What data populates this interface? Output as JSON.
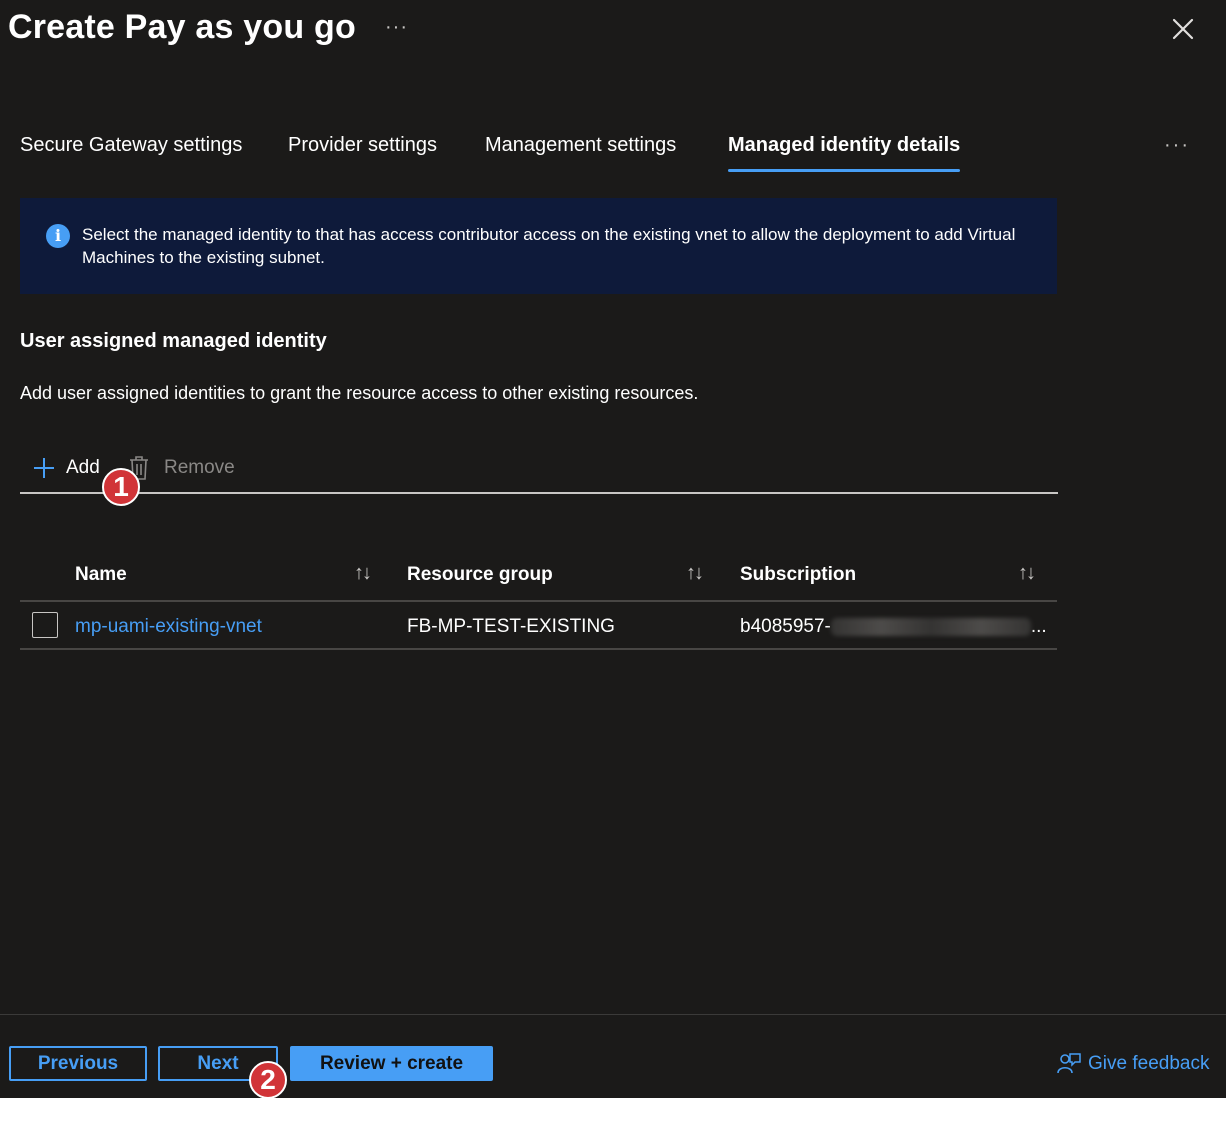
{
  "header": {
    "title": "Create Pay as you go",
    "more": "···"
  },
  "tabs": {
    "items": [
      {
        "label": "Secure Gateway settings"
      },
      {
        "label": "Provider settings"
      },
      {
        "label": "Management settings"
      },
      {
        "label": "Managed identity details",
        "active": true
      }
    ],
    "overflow": "···"
  },
  "info": {
    "icon": "info-icon",
    "text": "Select the managed identity to that has access contributor access on the existing vnet to allow the deployment to add Virtual Machines to the existing subnet."
  },
  "section": {
    "title": "User assigned managed identity",
    "description": "Add user assigned identities to grant the resource access to other existing resources."
  },
  "toolbar": {
    "add_label": "Add",
    "remove_label": "Remove"
  },
  "table": {
    "columns": [
      "Name",
      "Resource group",
      "Subscription"
    ],
    "sort_glyph": "↑↓",
    "rows": [
      {
        "name": "mp-uami-existing-vnet",
        "resource_group": "FB-MP-TEST-EXISTING",
        "subscription": "b4085957-",
        "subscription_suffix": "..."
      }
    ]
  },
  "annotations": {
    "badge1": "1",
    "badge2": "2",
    "badge_color": "#d13438"
  },
  "footer": {
    "previous_label": "Previous",
    "next_label": "Next",
    "review_label": "Review + create",
    "feedback_label": "Give feedback"
  },
  "colors": {
    "background": "#1b1a19",
    "accent": "#479ef5",
    "info_bg": "#0e1a3a"
  }
}
